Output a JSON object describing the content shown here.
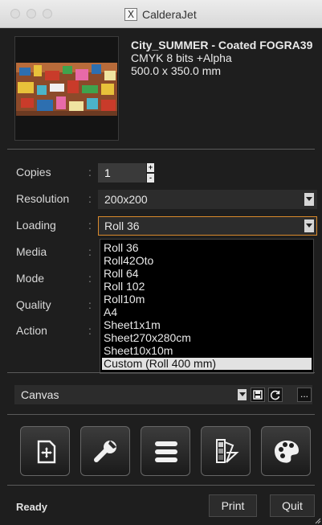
{
  "window": {
    "title": "CalderaJet"
  },
  "file": {
    "name": "City_SUMMER - Coated FOGRA39",
    "colorspace": "CMYK 8 bits +Alpha",
    "size": "500.0 x 350.0 mm"
  },
  "settings": {
    "copies": {
      "label": "Copies",
      "value": "1"
    },
    "resolution": {
      "label": "Resolution",
      "value": "200x200"
    },
    "loading": {
      "label": "Loading",
      "value": "Roll 36"
    },
    "media": {
      "label": "Media"
    },
    "mode": {
      "label": "Mode"
    },
    "quality": {
      "label": "Quality"
    },
    "action": {
      "label": "Action"
    },
    "colon": ":"
  },
  "loading_options": [
    "Roll 36",
    "Roll42Oto",
    "Roll 64",
    "Roll 102",
    "Roll10m",
    "A4",
    "Sheet1x1m",
    "Sheet270x280cm",
    "Sheet10x10m",
    "Custom (Roll 400 mm)"
  ],
  "selected_loading_option": "Custom (Roll 400 mm)",
  "canvas": {
    "value": "Canvas",
    "more_label": "..."
  },
  "toolbar": [
    "add-page-icon",
    "wrench-icon",
    "list-icon",
    "swatches-icon",
    "palette-icon"
  ],
  "footer": {
    "status": "Ready",
    "print_label": "Print",
    "quit_label": "Quit"
  },
  "title_icon_glyph": "X",
  "colors": {
    "accent": "#d98a2c",
    "background": "#1e1e1e",
    "text": "#e6e6e6"
  }
}
